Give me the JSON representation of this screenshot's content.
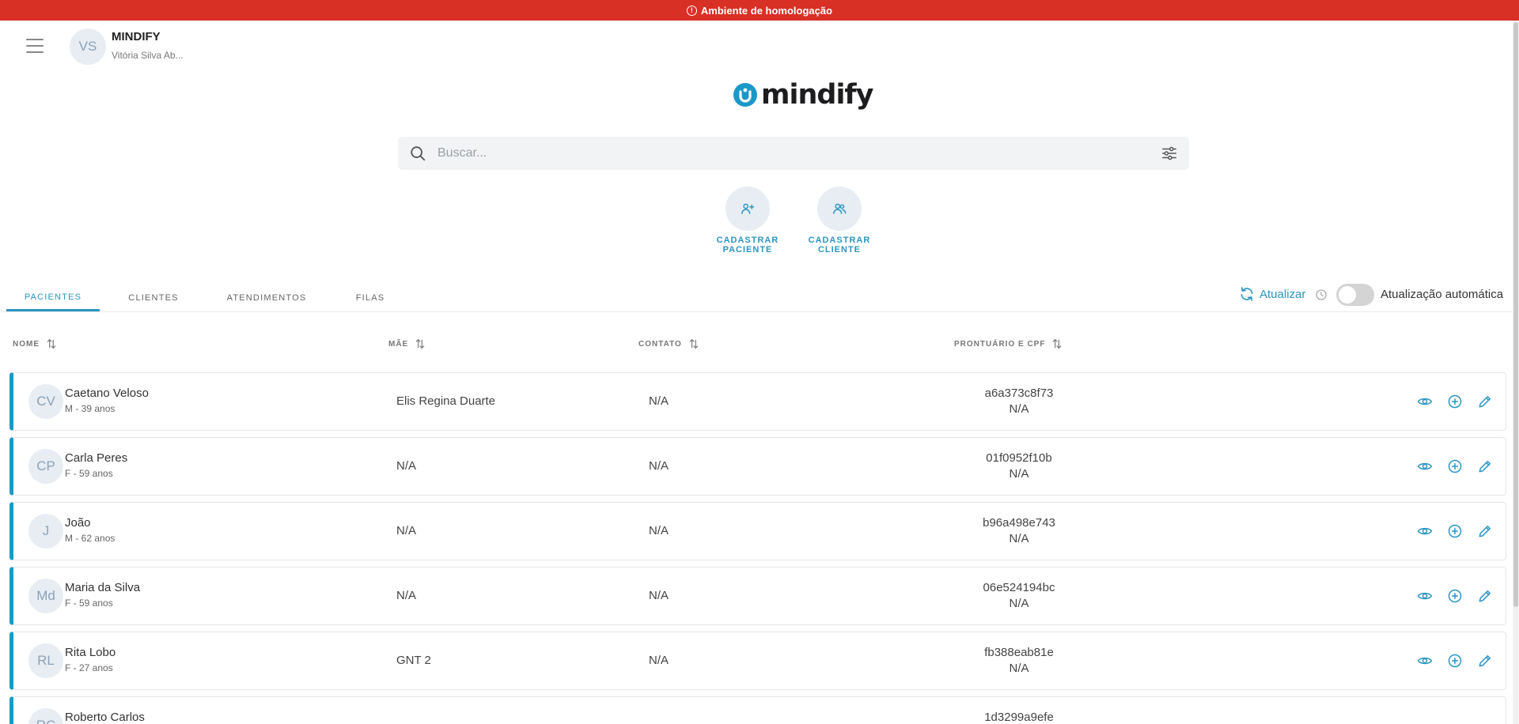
{
  "banner": {
    "text": "Ambiente de homologação",
    "color": "#d93025"
  },
  "header": {
    "avatar_initials": "VS",
    "org_name": "MINDIFY",
    "user_name": "Vitória Silva Ab..."
  },
  "logo": {
    "word": "mindify"
  },
  "search": {
    "placeholder": "Buscar...",
    "value": ""
  },
  "quick_actions": [
    {
      "line1": "CADASTRAR",
      "line2": "PACIENTE",
      "icon": "add-person-icon"
    },
    {
      "line1": "CADASTRAR",
      "line2": "CLIENTE",
      "icon": "people-icon"
    }
  ],
  "tabs": [
    {
      "label": "PACIENTES",
      "active": true
    },
    {
      "label": "CLIENTES",
      "active": false
    },
    {
      "label": "ATENDIMENTOS",
      "active": false
    },
    {
      "label": "FILAS",
      "active": false
    }
  ],
  "toolbar": {
    "refresh_label": "Atualizar",
    "auto_label": "Atualização automática",
    "auto_enabled": false
  },
  "columns": {
    "nome": "NOME",
    "mae": "MÃE",
    "contato": "CONTATO",
    "prontuario": "PRONTUÁRIO E CPF"
  },
  "patients": [
    {
      "initials": "CV",
      "name": "Caetano Veloso",
      "info": "M - 39 anos",
      "mae": "Elis Regina Duarte",
      "contato": "N/A",
      "prontuario": "a6a373c8f73",
      "cpf": "N/A"
    },
    {
      "initials": "CP",
      "name": "Carla Peres",
      "info": "F - 59 anos",
      "mae": "N/A",
      "contato": "N/A",
      "prontuario": "01f0952f10b",
      "cpf": "N/A"
    },
    {
      "initials": "J",
      "name": "João",
      "info": "M - 62 anos",
      "mae": "N/A",
      "contato": "N/A",
      "prontuario": "b96a498e743",
      "cpf": "N/A"
    },
    {
      "initials": "Md",
      "name": "Maria da Silva",
      "info": "F - 59 anos",
      "mae": "N/A",
      "contato": "N/A",
      "prontuario": "06e524194bc",
      "cpf": "N/A"
    },
    {
      "initials": "RL",
      "name": "Rita Lobo",
      "info": "F - 27 anos",
      "mae": "GNT 2",
      "contato": "N/A",
      "prontuario": "fb388eab81e",
      "cpf": "N/A"
    },
    {
      "initials": "RC",
      "name": "Roberto Carlos",
      "info": "",
      "mae": "",
      "contato": "",
      "prontuario": "1d3299a9efe",
      "cpf": ""
    }
  ],
  "colors": {
    "accent": "#2b96c2",
    "row_border": "#1a99c9",
    "avatar_bg": "#e7edf3"
  }
}
